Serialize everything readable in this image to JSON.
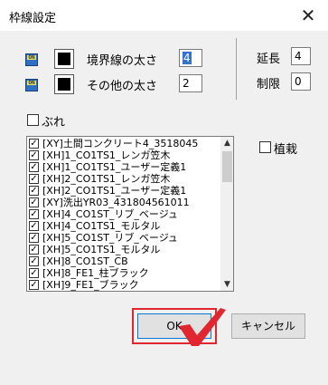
{
  "window": {
    "title": "枠線設定",
    "close_glyph": "✕"
  },
  "border": {
    "on_icon_text": "ON",
    "width_label": "境界線の太さ",
    "width_value": "4",
    "other_label": "その他の太さ",
    "other_value": "2",
    "extend_label": "延長",
    "extend_value": "4",
    "limit_label": "制限",
    "limit_value": "0"
  },
  "options": {
    "blur_label": "ぶれ",
    "plant_label": "植栽"
  },
  "list": {
    "check_glyph": "✓",
    "items": [
      "[XY]土間コンクリート4_3518045",
      "[XH]1_CO1TS1_レンガ笠木",
      "[XH]1_CO1TS1_ユーザー定義1",
      "[XH]2_CO1TS1_レンガ笠木",
      "[XH]2_CO1TS1_ユーザー定義1",
      "[XY]洗出YR03_431804561011",
      "[XH]4_CO1ST_リブ_ベージュ",
      "[XH]4_CO1TS1_モルタル",
      "[XH]5_CO1ST_リブ_ベージュ",
      "[XH]5_CO1TS1_モルタル",
      "[XH]8_CO1ST_CB",
      "[XH]8_FE1_柱ブラック",
      "[XH]9_FE1_ブラック"
    ],
    "scroll_up": "▲",
    "scroll_down": "▼"
  },
  "buttons": {
    "ok_label": "OK",
    "cancel_label": "キャンセル"
  },
  "colors": {
    "accent": "#0078d7",
    "annotation": "#e0262e"
  }
}
